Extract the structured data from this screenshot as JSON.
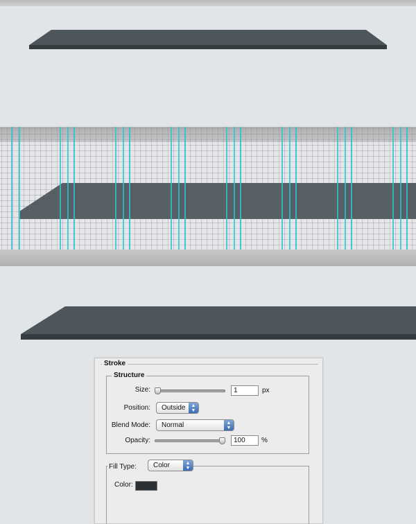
{
  "colors": {
    "page_bg": "#e2e5e7",
    "shelf_top": "#4d565b",
    "shelf_front": "#353c40",
    "guide": "#26c6d6",
    "grid_line": "#8a8c8e",
    "swatch": "#2b3034"
  },
  "stroke_dialog": {
    "title": "Stroke",
    "structure": {
      "legend": "Structure",
      "size_label": "Size:",
      "size_value": "1",
      "size_unit": "px",
      "size_slider_fraction": 0.0,
      "position_label": "Position:",
      "position_value": "Outside",
      "blend_label": "Blend Mode:",
      "blend_value": "Normal",
      "opacity_label": "Opacity:",
      "opacity_value": "100",
      "opacity_unit": "%",
      "opacity_slider_fraction": 1.0
    },
    "fill": {
      "type_label": "Fill Type:",
      "type_value": "Color",
      "color_label": "Color:",
      "color_value": "#2b3034"
    }
  }
}
